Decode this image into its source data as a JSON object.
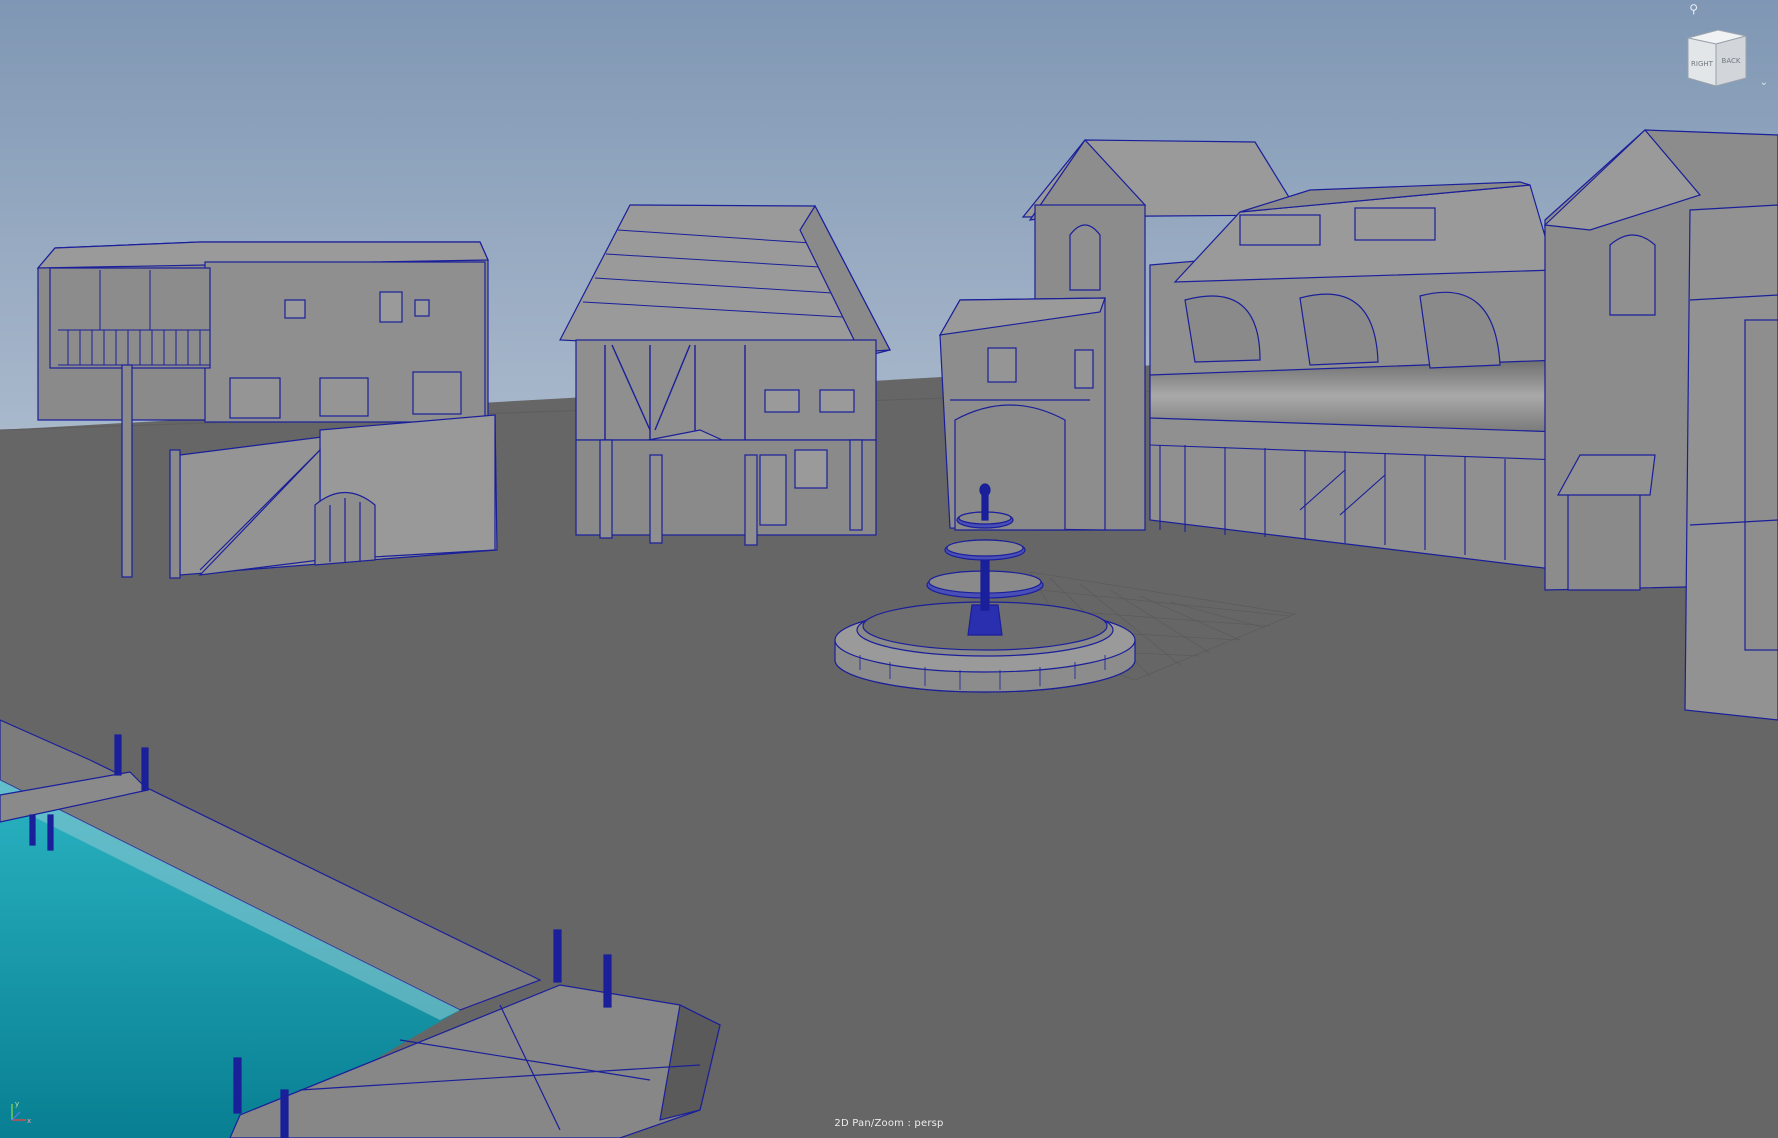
{
  "viewport": {
    "hud_label": "2D Pan/Zoom : persp",
    "camera": "persp"
  },
  "view_cube": {
    "face_right": "RIGHT",
    "face_back": "BACK"
  },
  "axis_gizmo": {
    "x_label": "x",
    "y_label": "y"
  },
  "colors": {
    "sky_top": "#7f97b4",
    "sky_bottom": "#a8b8cc",
    "ground": "#666666",
    "wireframe": "#1a1f9a",
    "building": "#8e8e8e",
    "water": "#1390a3"
  },
  "icons": [
    "view-cube-icon",
    "chevron-down-icon",
    "camera-marker-icon",
    "axis-gizmo-icon"
  ]
}
